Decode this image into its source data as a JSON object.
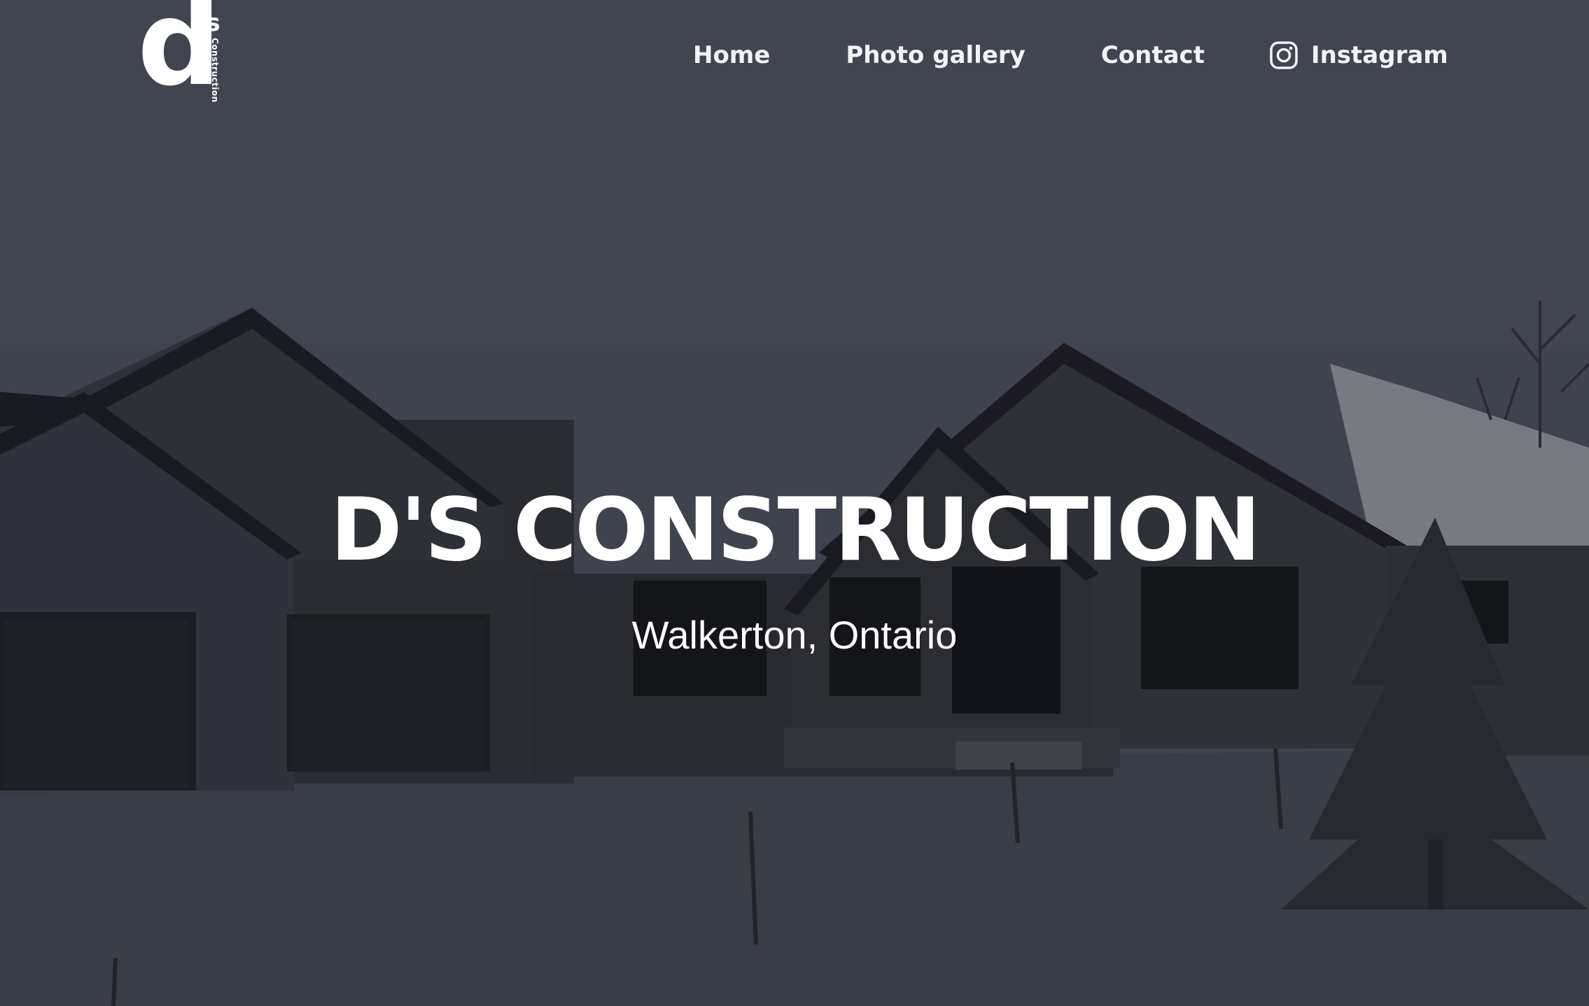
{
  "brand": {
    "logo_letter": "d",
    "logo_superscript": "'s",
    "logo_subtitle": "Construction"
  },
  "nav": {
    "items": [
      {
        "label": "Home"
      },
      {
        "label": "Photo gallery"
      },
      {
        "label": "Contact"
      },
      {
        "label": "Instagram",
        "icon": "instagram-icon"
      }
    ]
  },
  "hero": {
    "title": "D'S CONSTRUCTION",
    "subtitle": "Walkerton, Ontario",
    "background": "snowy-house-photo"
  },
  "colors": {
    "text": "#ffffff",
    "nav_text": "#f2f3f5",
    "sky": "#474d58",
    "snow": "#3d434c",
    "house": "#2b2d33"
  }
}
